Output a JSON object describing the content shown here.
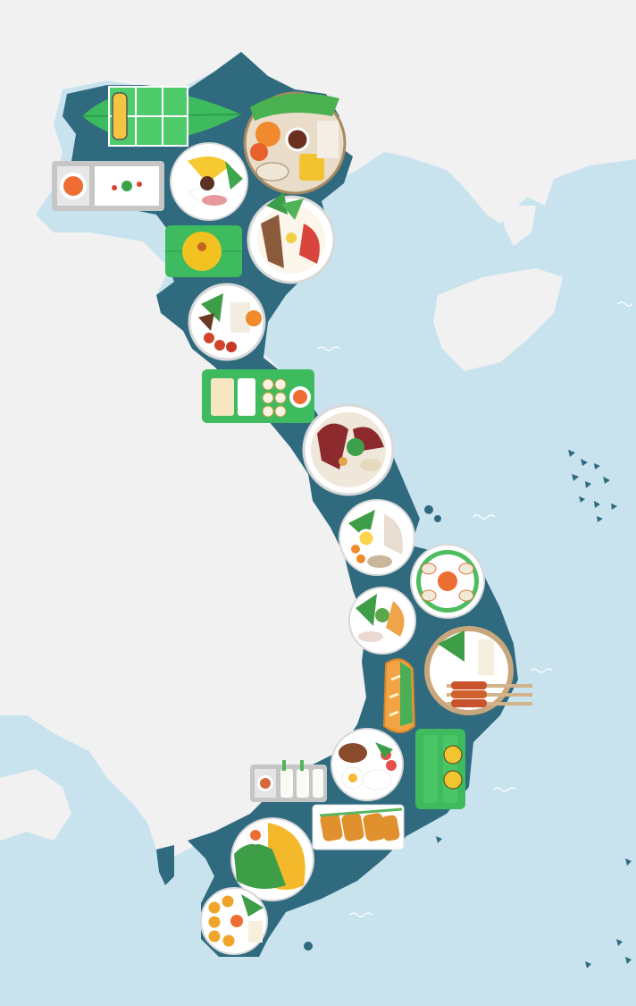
{
  "map": {
    "name": "vietnam-food-map",
    "colors": {
      "sea": "#c9e3ee",
      "land": "#f1f1f1",
      "vietnam": "#2f6a7f",
      "leaf_green": "#3dbb5e",
      "leaf_dark": "#2a9e4a",
      "plate": "#ffffff",
      "plate_rim": "#d8d8d8",
      "tray": "#c8c8c8",
      "wave": "#ffffff",
      "island_marker": "#2f6a7f"
    },
    "dishes": [
      {
        "id": "banh-chung",
        "icon": "leaf-wrapped-cake-icon"
      },
      {
        "id": "platter-north",
        "icon": "mixed-platter-icon"
      },
      {
        "id": "dipping-tray",
        "icon": "dipping-sauce-tray-icon"
      },
      {
        "id": "sticky-rice",
        "icon": "sticky-rice-plate-icon"
      },
      {
        "id": "xoi-leaf",
        "icon": "yellow-rice-on-leaf-icon"
      },
      {
        "id": "pho-bowl",
        "icon": "noodle-bowl-icon"
      },
      {
        "id": "grilled-plate",
        "icon": "grilled-meat-plate-icon"
      },
      {
        "id": "spring-roll-tray",
        "icon": "spring-roll-tray-icon"
      },
      {
        "id": "bun-bo",
        "icon": "beef-noodle-bowl-icon"
      },
      {
        "id": "banh-beo",
        "icon": "rice-cake-plate-icon"
      },
      {
        "id": "cao-lau",
        "icon": "herb-noodle-plate-icon"
      },
      {
        "id": "mi-quang",
        "icon": "quang-noodle-plate-icon"
      },
      {
        "id": "nem-lui",
        "icon": "skewer-plate-icon"
      },
      {
        "id": "banh-mi",
        "icon": "baguette-icon"
      },
      {
        "id": "com-tam",
        "icon": "broken-rice-plate-icon"
      },
      {
        "id": "banh-tet",
        "icon": "leaf-wrapped-log-icon"
      },
      {
        "id": "goi-cuon-tray",
        "icon": "fresh-roll-tray-icon"
      },
      {
        "id": "cha-gio",
        "icon": "fried-roll-tray-icon"
      },
      {
        "id": "banh-xeo",
        "icon": "savory-pancake-plate-icon"
      },
      {
        "id": "banh-khot",
        "icon": "mini-pancake-plate-icon"
      }
    ]
  }
}
